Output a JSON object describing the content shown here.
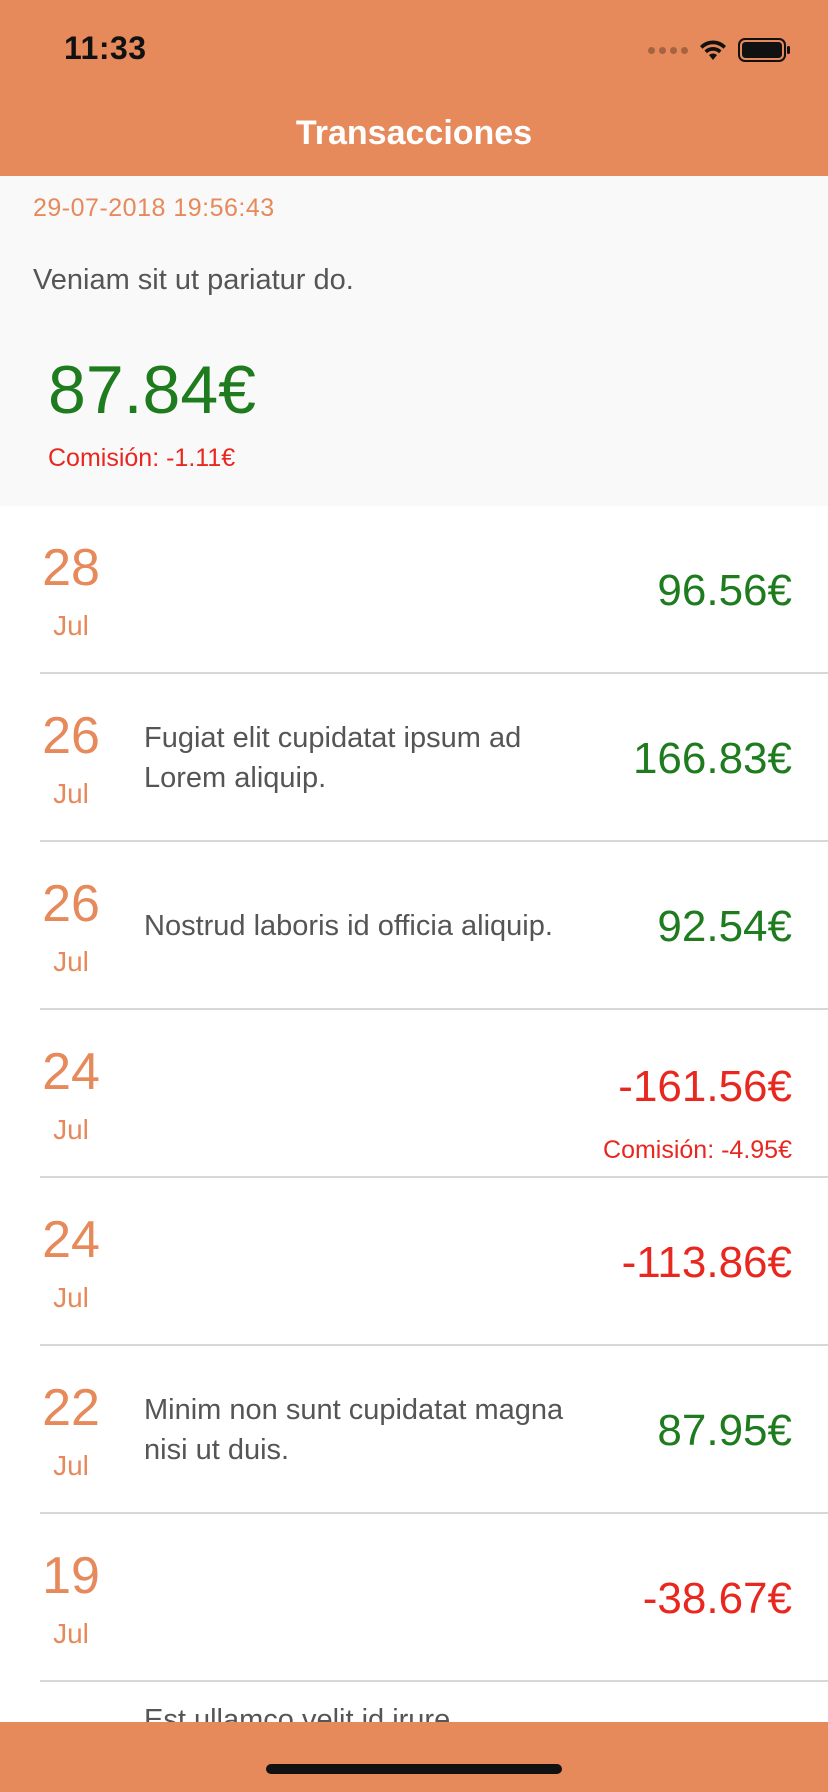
{
  "status_bar": {
    "time": "11:33"
  },
  "nav": {
    "title": "Transacciones"
  },
  "header": {
    "date": "29-07-2018 19:56:43",
    "description": "Veniam sit ut pariatur do.",
    "amount": "87.84€",
    "fee": "Comisión: -1.11€"
  },
  "transactions": [
    {
      "day": "28",
      "month": "Jul",
      "description": "",
      "amount": "96.56€",
      "fee": ""
    },
    {
      "day": "26",
      "month": "Jul",
      "description": "Fugiat elit cupidatat ipsum ad Lorem aliquip.",
      "amount": "166.83€",
      "fee": ""
    },
    {
      "day": "26",
      "month": "Jul",
      "description": "Nostrud laboris id officia aliquip.",
      "amount": "92.54€",
      "fee": ""
    },
    {
      "day": "24",
      "month": "Jul",
      "description": "",
      "amount": "-161.56€",
      "fee": "Comisión: -4.95€"
    },
    {
      "day": "24",
      "month": "Jul",
      "description": "",
      "amount": "-113.86€",
      "fee": ""
    },
    {
      "day": "22",
      "month": "Jul",
      "description": "Minim non sunt cupidatat magna nisi ut duis.",
      "amount": "87.95€",
      "fee": ""
    },
    {
      "day": "19",
      "month": "Jul",
      "description": "",
      "amount": "-38.67€",
      "fee": ""
    }
  ],
  "partial_row_text": "Est ullamco velit id irure.",
  "colors": {
    "accent": "#E6895B",
    "positive": "#1E7B1E",
    "negative": "#E8271F"
  }
}
